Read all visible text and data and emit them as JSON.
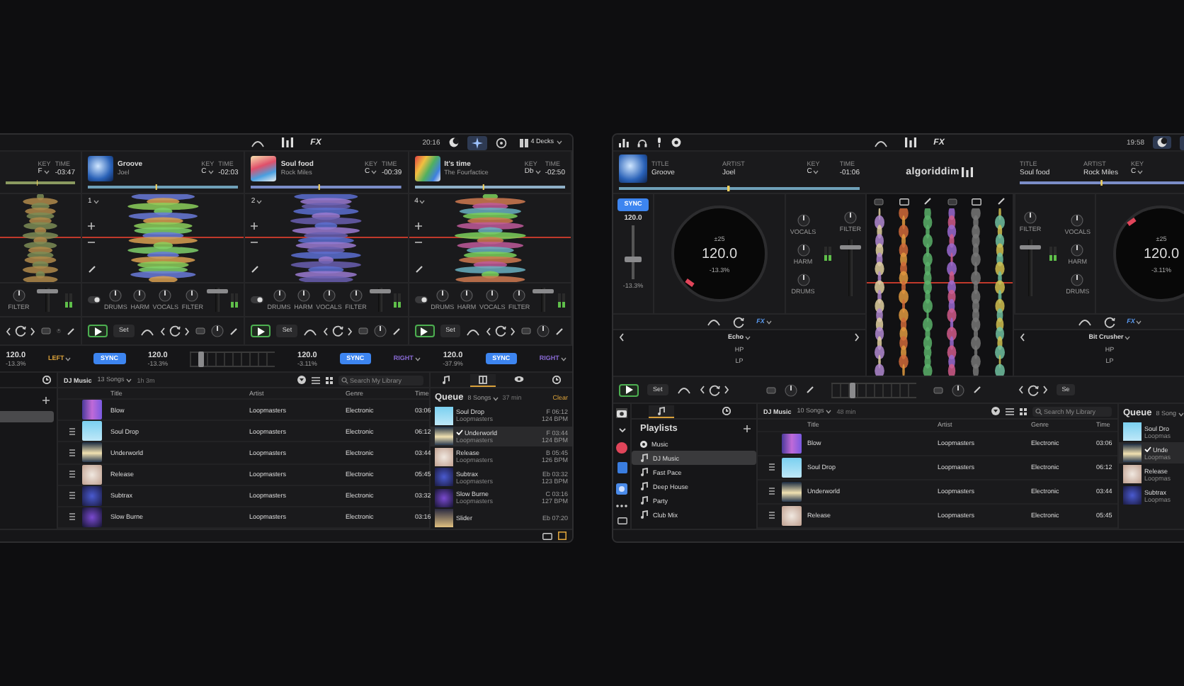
{
  "left_window": {
    "toolbar": {
      "fx": "FX",
      "clock": "20:16",
      "decks_menu": "4 Decks"
    },
    "decks": [
      {
        "key_label": "KEY",
        "key": "F",
        "time_label": "TIME",
        "time": "-03:47",
        "knobs": [
          "FILTER"
        ],
        "fader": {
          "level": 0.9
        }
      },
      {
        "number": "1",
        "title": "Groove",
        "artist": "Joel",
        "key_label": "KEY",
        "key": "C",
        "time_label": "TIME",
        "time": "-02:03",
        "knobs": [
          "DRUMS",
          "HARM",
          "VOCALS",
          "FILTER"
        ],
        "fader": {
          "level": 0.9
        },
        "set": "Set"
      },
      {
        "number": "2",
        "title": "Soul food",
        "artist": "Rock Miles",
        "key_label": "KEY",
        "key": "C",
        "time_label": "TIME",
        "time": "-00:39",
        "knobs": [
          "DRUMS",
          "HARM",
          "VOCALS",
          "FILTER"
        ],
        "fader": {
          "level": 0.9
        },
        "set": "Set"
      },
      {
        "number": "4",
        "title": "It's time",
        "artist": "The Fourfactice",
        "key_label": "KEY",
        "key": "Db",
        "time_label": "TIME",
        "time": "-02:50",
        "knobs": [
          "DRUMS",
          "HARM",
          "VOCALS",
          "FILTER"
        ],
        "fader": {
          "level": 0.9
        },
        "set": "Set"
      }
    ],
    "tempo_bar": [
      {
        "kind": "bpm",
        "bpm": "120.0",
        "pitch": "-13.3%"
      },
      {
        "kind": "side",
        "label": "LEFT",
        "color": "#d9a03a"
      },
      {
        "kind": "sync",
        "label": "SYNC",
        "on": true
      },
      {
        "kind": "bpm",
        "bpm": "120.0",
        "pitch": "-13.3%"
      },
      {
        "kind": "crossfader",
        "level": 0.1
      },
      {
        "kind": "bpm",
        "bpm": "120.0",
        "pitch": "-3.11%"
      },
      {
        "kind": "sync",
        "label": "SYNC",
        "on": true
      },
      {
        "kind": "side",
        "label": "RIGHT",
        "color": "#8a6bd6"
      },
      {
        "kind": "bpm",
        "bpm": "120.0",
        "pitch": "-37.9%"
      },
      {
        "kind": "sync",
        "label": "SYNC",
        "on": true
      },
      {
        "kind": "side",
        "label": "RIGHT",
        "color": "#8a6bd6"
      }
    ],
    "library": {
      "browser": {
        "title": "DJ Music",
        "count": "13 Songs",
        "duration": "1h 3m",
        "search_placeholder": "Search My Library",
        "columns": [
          "Title",
          "Artist",
          "Genre",
          "Time"
        ],
        "rows": [
          {
            "title": "Blow",
            "artist": "Loopmasters",
            "genre": "Electronic",
            "time": "03:06",
            "handle": false
          },
          {
            "title": "Soul Drop",
            "artist": "Loopmasters",
            "genre": "Electronic",
            "time": "06:12",
            "handle": true
          },
          {
            "title": "Underworld",
            "artist": "Loopmasters",
            "genre": "Electronic",
            "time": "03:44",
            "handle": true
          },
          {
            "title": "Release",
            "artist": "Loopmasters",
            "genre": "Electronic",
            "time": "05:45",
            "handle": true
          },
          {
            "title": "Subtrax",
            "artist": "Loopmasters",
            "genre": "Electronic",
            "time": "03:32",
            "handle": true
          },
          {
            "title": "Slow Burne",
            "artist": "Loopmasters",
            "genre": "Electronic",
            "time": "03:16",
            "handle": true
          }
        ]
      },
      "queue": {
        "tabs": [
          {
            "kind": "playlist",
            "selected": false
          },
          {
            "kind": "queue",
            "selected": true
          },
          {
            "kind": "preview",
            "selected": false
          },
          {
            "kind": "history",
            "selected": false
          }
        ],
        "title": "Queue",
        "count": "8 Songs",
        "duration": "37 min",
        "clear": "Clear",
        "items": [
          {
            "title": "Soul Drop",
            "artist": "Loopmasters",
            "key_time": "F 06:12",
            "bpm": "124 BPM",
            "playing": false
          },
          {
            "title": "Underworld",
            "artist": "Loopmasters",
            "key_time": "F 03:44",
            "bpm": "124 BPM",
            "playing": true
          },
          {
            "title": "Release",
            "artist": "Loopmasters",
            "key_time": "B 05:45",
            "bpm": "126 BPM",
            "playing": false
          },
          {
            "title": "Subtrax",
            "artist": "Loopmasters",
            "key_time": "Eb 03:32",
            "bpm": "123 BPM",
            "playing": false
          },
          {
            "title": "Slow Burne",
            "artist": "Loopmasters",
            "key_time": "C 03:16",
            "bpm": "127 BPM",
            "playing": false
          },
          {
            "title": "Slider",
            "key_time": "Eb 07:20",
            "playing": false
          }
        ]
      }
    }
  },
  "right_window": {
    "toolbar": {
      "fx": "FX",
      "clock": "19:58"
    },
    "logo": "algoriddim",
    "decks": [
      {
        "title_label": "TITLE",
        "title": "Groove",
        "artist_label": "ARTIST",
        "artist": "Joel",
        "key_label": "KEY",
        "key": "C",
        "time_label": "TIME",
        "time": "-01:06",
        "sync": {
          "label": "SYNC",
          "on": true
        },
        "bpm": "120.0",
        "pitch": "-13.3%",
        "pitch_fader": {
          "level": 0.35
        },
        "platter": {
          "range": "±25",
          "bpm": "120.0",
          "pitch": "-13.3%"
        },
        "knobs": [
          "VOCALS",
          "HARM",
          "DRUMS"
        ],
        "filter": "FILTER",
        "fader": {
          "level": 0.9
        },
        "fx": {
          "menu": "FX",
          "effect": "Echo",
          "params": [
            "HP",
            "LP"
          ]
        },
        "set": "Set"
      },
      {
        "title_label": "TITLE",
        "title": "Soul food",
        "artist_label": "ARTIST",
        "artist": "Rock Miles",
        "key_label": "KEY",
        "key": "C",
        "platter": {
          "range": "±25",
          "bpm": "120.0",
          "pitch": "-3.11%"
        },
        "knobs": [
          "VOCALS",
          "HARM",
          "DRUMS"
        ],
        "filter": "FILTER",
        "fader": {
          "level": 0.9
        },
        "fx": {
          "menu": "FX",
          "effect": "Bit Crusher",
          "params": [
            "HP",
            "LP"
          ]
        },
        "set": "Se"
      }
    ],
    "crossfader": {
      "level": 0.25
    },
    "library": {
      "playlists": {
        "tabs": [
          {
            "kind": "playlist",
            "selected": true
          },
          {
            "kind": "history",
            "selected": false
          }
        ],
        "title": "Playlists",
        "items": [
          {
            "label": "Music",
            "kind": "library",
            "selected": false
          },
          {
            "label": "DJ Music",
            "kind": "playlist",
            "selected": true
          },
          {
            "label": "Fast Pace",
            "kind": "playlist",
            "selected": false
          },
          {
            "label": "Deep House",
            "kind": "playlist",
            "selected": false
          },
          {
            "label": "Party",
            "kind": "playlist",
            "selected": false
          },
          {
            "label": "Club Mix",
            "kind": "playlist",
            "selected": false
          }
        ]
      },
      "browser": {
        "title": "DJ Music",
        "count": "10 Songs",
        "duration": "48 min",
        "search_placeholder": "Search My Library",
        "columns": [
          "Title",
          "Artist",
          "Genre",
          "Time"
        ],
        "rows": [
          {
            "title": "Blow",
            "artist": "Loopmasters",
            "genre": "Electronic",
            "time": "03:06",
            "handle": false
          },
          {
            "title": "Soul Drop",
            "artist": "Loopmasters",
            "genre": "Electronic",
            "time": "06:12",
            "handle": true
          },
          {
            "title": "Underworld",
            "artist": "Loopmasters",
            "genre": "Electronic",
            "time": "03:44",
            "handle": true
          },
          {
            "title": "Release",
            "artist": "Loopmasters",
            "genre": "Electronic",
            "time": "05:45",
            "handle": true
          }
        ]
      },
      "queue": {
        "title": "Queue",
        "count": "8 Song",
        "items": [
          {
            "title": "Soul Dro",
            "artist": "Loopmas",
            "playing": false
          },
          {
            "title": "Unde",
            "artist": "Loopmas",
            "playing": true
          },
          {
            "title": "Release",
            "artist": "Loopmas",
            "playing": false
          },
          {
            "title": "Subtrax",
            "artist": "Loopmas",
            "playing": false
          }
        ]
      }
    }
  }
}
